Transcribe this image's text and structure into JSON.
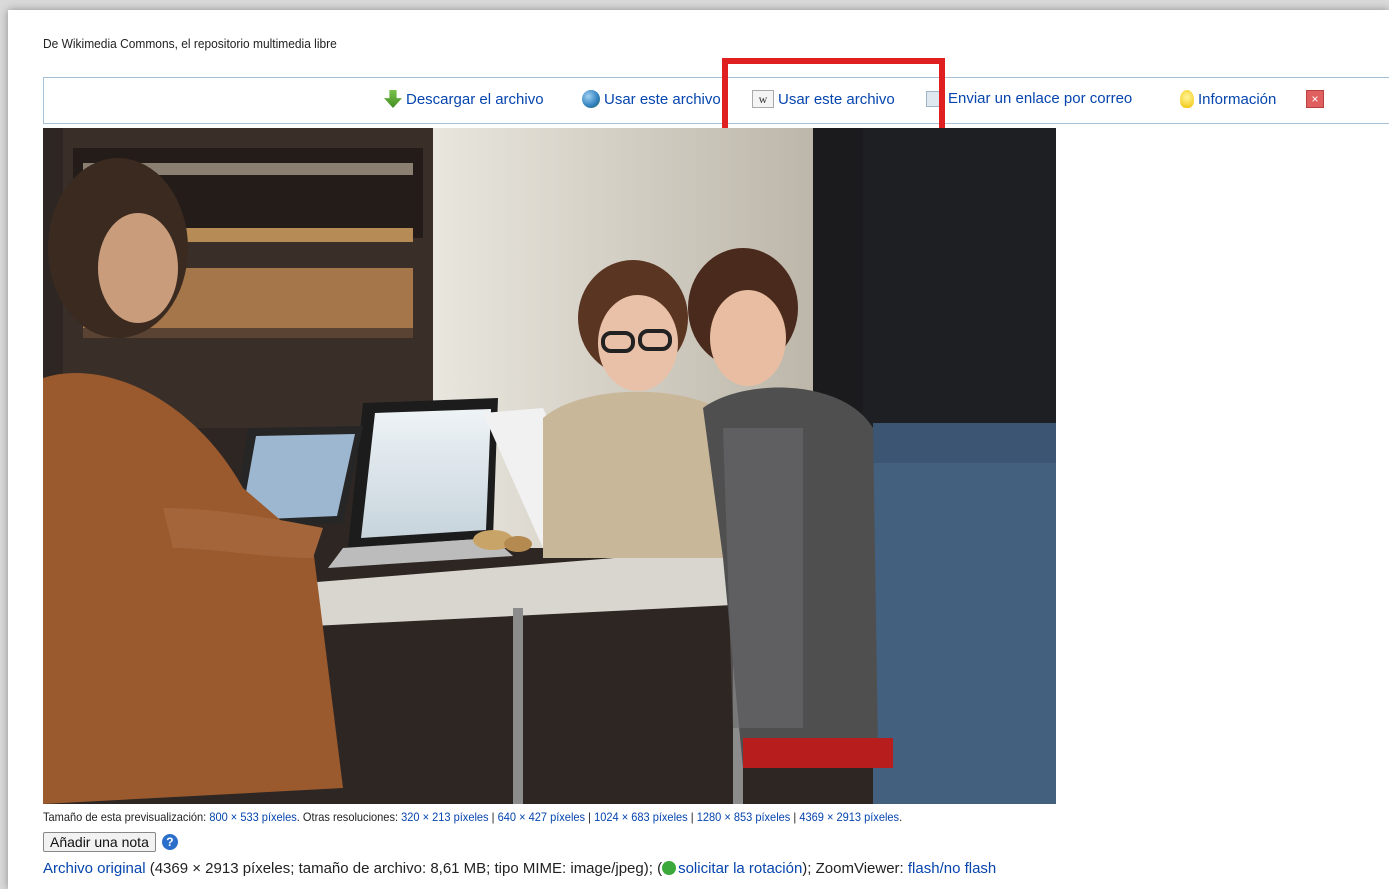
{
  "source_text": "De Wikimedia Commons, el repositorio multimedia libre",
  "toolbar": {
    "download": {
      "label": "Descargar el archivo",
      "icon": "download-icon"
    },
    "use_web": {
      "label": "Usar este archivo",
      "icon": "globe-icon"
    },
    "use_wiki": {
      "label": "Usar este archivo",
      "icon": "wikipedia-w-icon"
    },
    "email": {
      "label": "Enviar un enlace por correo",
      "icon": "mail-icon"
    },
    "info": {
      "label": "Información",
      "icon": "lightbulb-icon"
    },
    "close_icon": "close-icon"
  },
  "highlight_color": "#e02020",
  "preview": {
    "label": "Tamaño de esta previsualización:",
    "current": "800 × 533 píxeles",
    "other_label": ". Otras resoluciones:",
    "resolutions": [
      "320 × 213 píxeles",
      "640 × 427 píxeles",
      "1024 × 683 píxeles",
      "1280 × 853 píxeles",
      "4369 × 2913 píxeles"
    ],
    "separator": " | ",
    "end": "."
  },
  "note": {
    "button_label": "Añadir una nota",
    "help_glyph": "?"
  },
  "original": {
    "link": "Archivo original",
    "details": " (4369 × 2913 píxeles; tamaño de archivo: 8,61 MB; tipo MIME: image/jpeg); (",
    "rotate_link": "solicitar la rotación",
    "after_rotate": "); ZoomViewer: ",
    "zoom_link": "flash/no flash"
  }
}
